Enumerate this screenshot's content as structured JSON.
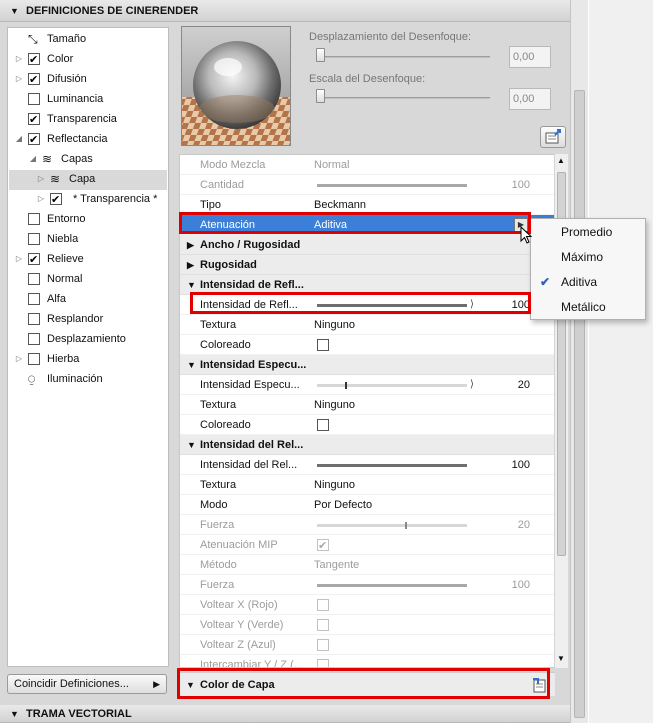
{
  "header": {
    "title": "DEFINICIONES DE CINERENDER",
    "bottom_title": "TRAMA VECTORIAL"
  },
  "tree": {
    "items": [
      {
        "label": "Tamaño",
        "icon": "resize-icon",
        "checkbox": null,
        "expandable": false,
        "level": 0
      },
      {
        "label": "Color",
        "checkbox": true,
        "expandable": true,
        "level": 0
      },
      {
        "label": "Difusión",
        "checkbox": true,
        "expandable": true,
        "level": 0
      },
      {
        "label": "Luminancia",
        "checkbox": false,
        "expandable": false,
        "level": 0
      },
      {
        "label": "Transparencia",
        "checkbox": true,
        "expandable": false,
        "level": 0
      },
      {
        "label": "Reflectancia",
        "checkbox": true,
        "expandable": true,
        "expanded": true,
        "level": 0
      },
      {
        "label": "Capas",
        "icon": "layers-icon",
        "checkbox": null,
        "expandable": true,
        "expanded": true,
        "level": 1
      },
      {
        "label": "Capa",
        "icon": "layer-icon",
        "checkbox": null,
        "expandable": true,
        "level": 2,
        "selected": true
      },
      {
        "label": "* Transparencia *",
        "checkbox": true,
        "expandable": true,
        "level": 2
      },
      {
        "label": "Entorno",
        "checkbox": false,
        "expandable": false,
        "level": 0
      },
      {
        "label": "Niebla",
        "checkbox": false,
        "expandable": false,
        "level": 0
      },
      {
        "label": "Relieve",
        "checkbox": true,
        "expandable": true,
        "level": 0
      },
      {
        "label": "Normal",
        "checkbox": false,
        "expandable": false,
        "level": 0
      },
      {
        "label": "Alfa",
        "checkbox": false,
        "expandable": false,
        "level": 0
      },
      {
        "label": "Resplandor",
        "checkbox": false,
        "expandable": false,
        "level": 0
      },
      {
        "label": "Desplazamiento",
        "checkbox": false,
        "expandable": false,
        "level": 0
      },
      {
        "label": "Hierba",
        "checkbox": false,
        "expandable": true,
        "level": 0
      },
      {
        "label": "Iluminación",
        "icon": "bulb-icon",
        "checkbox": null,
        "expandable": false,
        "level": 0
      }
    ],
    "match_button": "Coincidir Definiciones..."
  },
  "preview": {
    "blur_offset_label": "Desplazamiento del Desenfoque:",
    "blur_offset_value": "0,00",
    "blur_scale_label": "Escala del Desenfoque:",
    "blur_scale_value": "0,00"
  },
  "properties": [
    {
      "type": "row",
      "key": "Modo Mezcla",
      "value": "Normal",
      "disabled": true
    },
    {
      "type": "slider",
      "key": "Cantidad",
      "num": "100",
      "fill": 1.0,
      "disabled": true
    },
    {
      "type": "row",
      "key": "Tipo",
      "value": "Beckmann"
    },
    {
      "type": "row",
      "key": "Atenuación",
      "value": "Aditiva",
      "selected": true
    },
    {
      "type": "group",
      "key": "Ancho / Rugosidad",
      "collapsed": true
    },
    {
      "type": "group",
      "key": "Rugosidad",
      "collapsed": true
    },
    {
      "type": "group",
      "key": "Intensidad de Refl...",
      "collapsed": false
    },
    {
      "type": "slider",
      "key": "Intensidad de Refl...",
      "num": "100",
      "fill": 1.0,
      "chevron": true
    },
    {
      "type": "row",
      "key": "Textura",
      "value": "Ninguno"
    },
    {
      "type": "checkbox",
      "key": "Coloreado",
      "checked": false
    },
    {
      "type": "group",
      "key": "Intensidad Especu...",
      "collapsed": false
    },
    {
      "type": "slider",
      "key": "Intensidad Especu...",
      "num": "20",
      "fill": 0.2,
      "chevron": true
    },
    {
      "type": "row",
      "key": "Textura",
      "value": "Ninguno"
    },
    {
      "type": "checkbox",
      "key": "Coloreado",
      "checked": false
    },
    {
      "type": "group",
      "key": "Intensidad del Rel...",
      "collapsed": false
    },
    {
      "type": "slider",
      "key": "Intensidad del Rel...",
      "num": "100",
      "fill": 1.0
    },
    {
      "type": "row",
      "key": "Textura",
      "value": "Ninguno"
    },
    {
      "type": "row",
      "key": "Modo",
      "value": "Por Defecto"
    },
    {
      "type": "slider",
      "key": "Fuerza",
      "num": "20",
      "fill": 0.6,
      "disabled": true
    },
    {
      "type": "checkbox",
      "key": "Atenuación MIP",
      "checked": true,
      "disabled": true
    },
    {
      "type": "row",
      "key": "Método",
      "value": "Tangente",
      "disabled": true
    },
    {
      "type": "slider",
      "key": "Fuerza",
      "num": "100",
      "fill": 1.0,
      "disabled": true
    },
    {
      "type": "checkbox",
      "key": "Voltear X (Rojo)",
      "checked": false,
      "disabled": true
    },
    {
      "type": "checkbox",
      "key": "Voltear Y (Verde)",
      "checked": false,
      "disabled": true
    },
    {
      "type": "checkbox",
      "key": "Voltear Z (Azul)",
      "checked": false,
      "disabled": true
    },
    {
      "type": "checkbox",
      "key": "Intercambiar Y / Z (...",
      "checked": false,
      "disabled": true
    }
  ],
  "color_capa": {
    "label": "Color de Capa"
  },
  "popup": {
    "options": [
      "Promedio",
      "Máximo",
      "Aditiva",
      "Metálico"
    ],
    "selected": "Aditiva"
  },
  "colors": {
    "selection": "#3b7fd8",
    "highlight": "#e00000"
  }
}
